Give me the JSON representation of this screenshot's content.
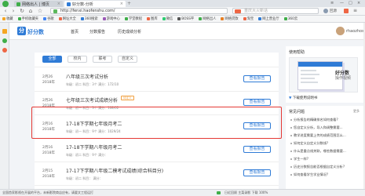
{
  "browser": {
    "tabs": [
      {
        "label": "网络出人 | 博页"
      },
      {
        "label": "好分数-分析"
      }
    ],
    "url": "http://fenxi.haofenshu.com/",
    "search_placeholder": "重庆大火新话",
    "user_label": "回源",
    "bookmarks": [
      {
        "label": "收藏"
      },
      {
        "label": "手机收藏夹"
      },
      {
        "label": "谷歌"
      },
      {
        "label": "网址大全"
      },
      {
        "label": "360搜索"
      },
      {
        "label": "游戏中心"
      },
      {
        "label": "学堂教程"
      },
      {
        "label": "图库"
      },
      {
        "label": "微信"
      },
      {
        "label": "BOSS平"
      },
      {
        "label": "网络出人"
      },
      {
        "label": "网络贷款"
      },
      {
        "label": "淘宝"
      },
      {
        "label": "网上营业厅"
      },
      {
        "label": "360云"
      }
    ]
  },
  "site": {
    "logo_mark": "分",
    "logo_text": "好分数",
    "nav": [
      {
        "label": "首页"
      },
      {
        "label": "分数报告"
      },
      {
        "label": "历史成绩分析"
      }
    ],
    "user_name": "rhaozhoshu"
  },
  "filters": [
    {
      "label": "全部",
      "active": true
    },
    {
      "label": "校内",
      "active": false
    },
    {
      "label": "联考",
      "active": false
    },
    {
      "label": "自定义",
      "active": false
    }
  ],
  "exams": [
    {
      "month": "2月26",
      "year": "2018年",
      "title": "八年级三次考试分析",
      "badge": "",
      "meta": "年级：初二   科目：3个   满分：172/10"
    },
    {
      "month": "2月26",
      "year": "2018年",
      "title": "七年级三次考试成绩分析",
      "badge": "待定义",
      "meta": "年级：初一   科目：3个   满分：108/02"
    },
    {
      "month": "2月16",
      "year": "2018年",
      "title": "17-18下学期七年级月考二",
      "badge": "",
      "meta": "年级：初一   科目：9个   满分：1029/24"
    },
    {
      "month": "2月16",
      "year": "2018年",
      "title": "17-18下学期八年级月考二",
      "badge": "",
      "meta": "年级：初二   科目：9个   满分："
    },
    {
      "month": "2月15",
      "year": "2018年",
      "title": "17-17下学期八年级二模考试成绩(综合科目分)",
      "badge": "",
      "meta": "年级：初二   科目：   满分："
    }
  ],
  "view_report_label": "查看报告",
  "right_panel": {
    "guide_title": "使用帮助",
    "video_title": "好分数",
    "video_subtitle": "操作视频",
    "download_label": "下载使用说明书",
    "faq_title": "常见问题",
    "faq_more": "更多",
    "faq": [
      {
        "label": "分析报告的精确排名如何查看?"
      },
      {
        "label": "您自定义分析，导入和调整需要..."
      },
      {
        "label": "教学进度需要上传的成绩范围怎么..."
      },
      {
        "label": "如何定义自定义分数线?"
      },
      {
        "label": "什么是重点线关联，哪些数据需要..."
      },
      {
        "label": "学生一样?"
      },
      {
        "label": "历史分数报告能否根据自定义分析?"
      },
      {
        "label": "如何查看学生学业情况?"
      }
    ]
  },
  "status_bar": {
    "left_text": "全国首家影视在开展的平台，未新影院商店应有，请要文工程运打",
    "right_text": "日近回顾   主菜录影   下载   100%"
  },
  "colors": {
    "brand": "#2f7bd6",
    "highlight": "#e53935"
  }
}
